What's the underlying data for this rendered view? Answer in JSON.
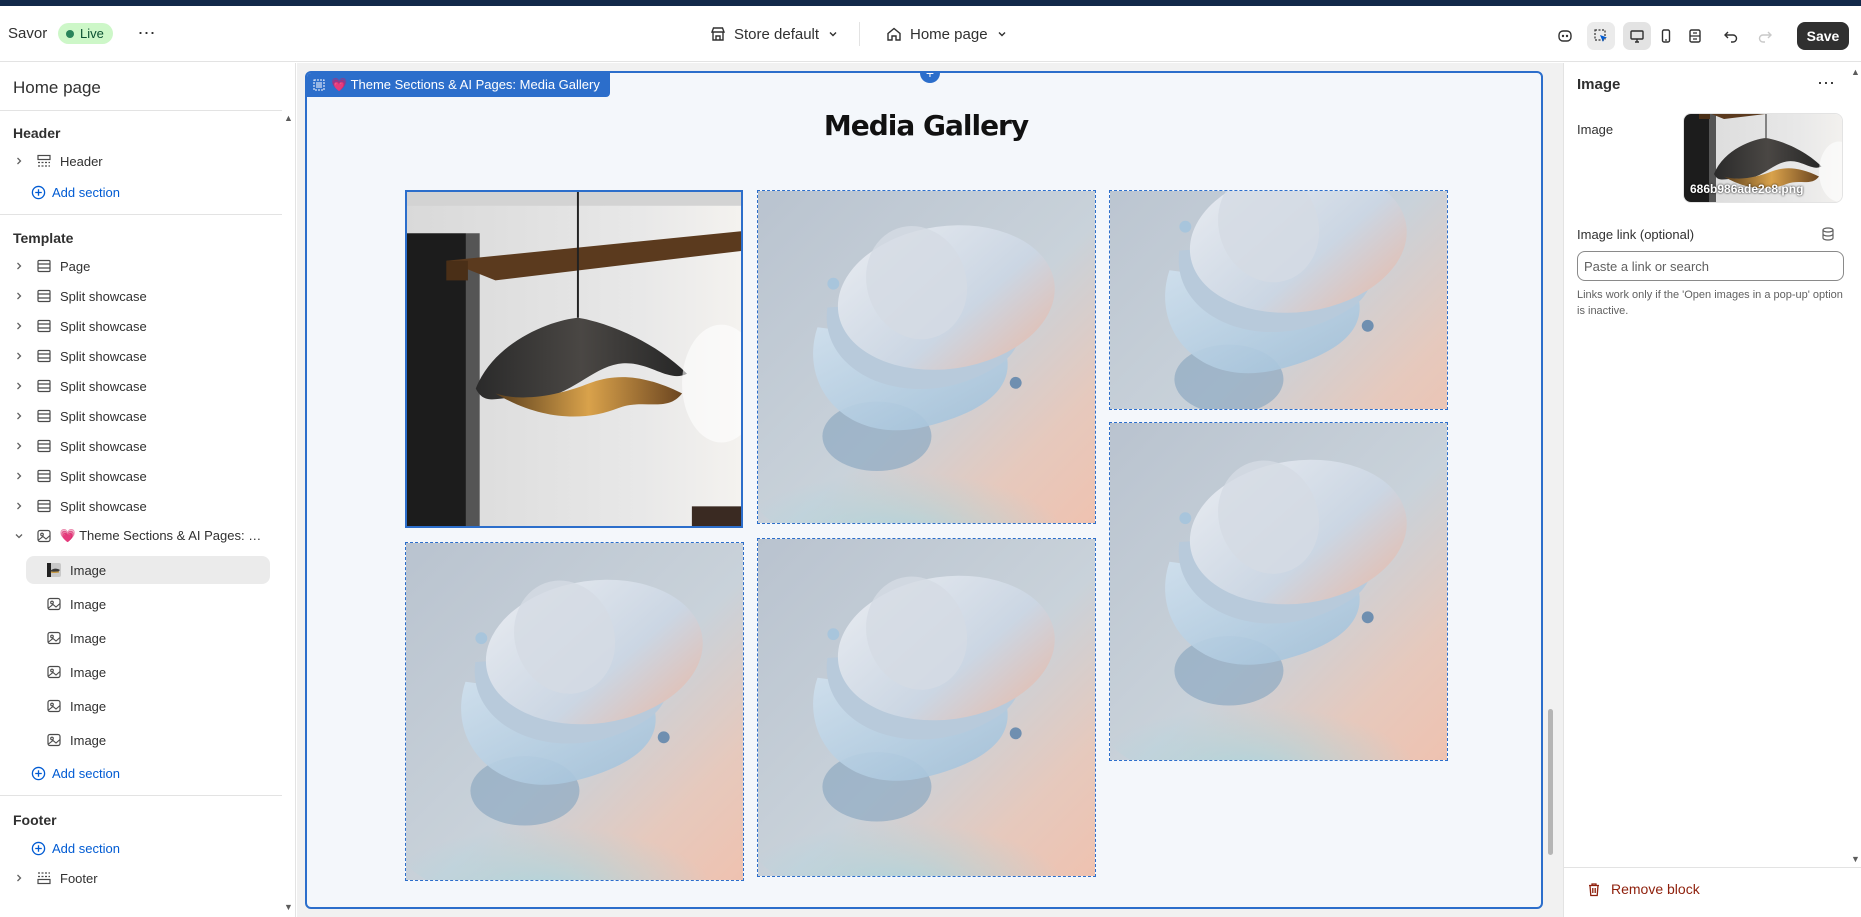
{
  "topbar": {
    "store_name": "Savor",
    "live_label": "Live",
    "theme_select": "Store default",
    "page_select": "Home page",
    "save_label": "Save"
  },
  "sidebar": {
    "title": "Home page",
    "header_group": "Header",
    "header_item": "Header",
    "add_section": "Add section",
    "template_group": "Template",
    "template_items": [
      "Page",
      "Split showcase",
      "Split showcase",
      "Split showcase",
      "Split showcase",
      "Split showcase",
      "Split showcase",
      "Split showcase",
      "Split showcase"
    ],
    "media_section": "💗 Theme Sections & AI Pages: Me...",
    "image_blocks": [
      "Image",
      "Image",
      "Image",
      "Image",
      "Image",
      "Image"
    ],
    "footer_group": "Footer",
    "footer_item": "Footer"
  },
  "canvas": {
    "section_tag": "💗 Theme Sections & AI Pages: Media Gallery",
    "gallery_title": "Media Gallery"
  },
  "right_panel": {
    "title": "Image",
    "image_label": "Image",
    "image_filename": "686b986ade2c8.png",
    "link_label": "Image link (optional)",
    "link_placeholder": "Paste a link or search",
    "help_text": "Links work only if the 'Open images in a pop-up' option is inactive.",
    "remove_label": "Remove block"
  },
  "colors": {
    "accent": "#2c6ecb",
    "live_bg": "#cdf7c8",
    "danger": "#8e1f0b",
    "link": "#005bd3"
  }
}
